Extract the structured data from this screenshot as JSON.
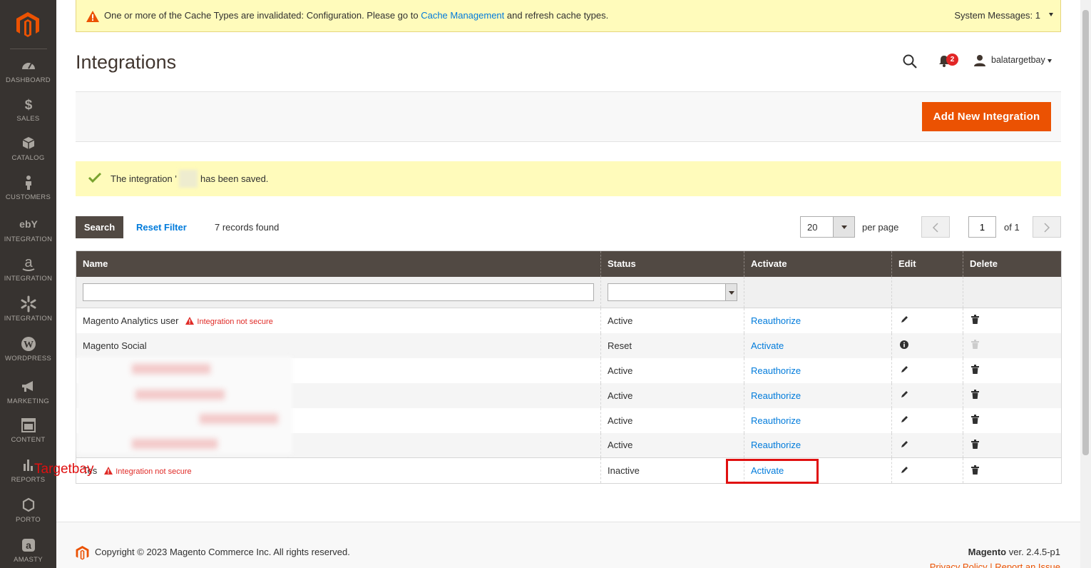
{
  "colors": {
    "sidebar": "#373330",
    "accent": "#eb5202",
    "link": "#007bdb",
    "header_bar": "#514943",
    "warning": "#e02b27"
  },
  "sidebar": {
    "items": [
      {
        "label": "DASHBOARD",
        "icon": "dashboard-icon"
      },
      {
        "label": "SALES",
        "icon": "dollar-icon"
      },
      {
        "label": "CATALOG",
        "icon": "cube-icon"
      },
      {
        "label": "CUSTOMERS",
        "icon": "person-icon"
      },
      {
        "label": "INTEGRATION",
        "icon": "ebay-icon"
      },
      {
        "label": "INTEGRATION",
        "icon": "amazon-icon"
      },
      {
        "label": "INTEGRATION",
        "icon": "walmart-icon"
      },
      {
        "label": "WORDPRESS",
        "icon": "wordpress-icon"
      },
      {
        "label": "MARKETING",
        "icon": "megaphone-icon"
      },
      {
        "label": "CONTENT",
        "icon": "content-icon"
      },
      {
        "label": "REPORTS",
        "icon": "bar-chart-icon"
      },
      {
        "label": "PORTO",
        "icon": "hexagon-icon"
      },
      {
        "label": "AMASTY",
        "icon": "amasty-icon"
      }
    ]
  },
  "system_message": {
    "text_before": "One or more of the Cache Types are invalidated: Configuration. Please go to ",
    "link": "Cache Management",
    "text_after": " and refresh cache types.",
    "count": "System Messages: 1"
  },
  "header": {
    "title": "Integrations",
    "notifications": "2",
    "username": "balatargetbay"
  },
  "actions": {
    "add_new": "Add New Integration"
  },
  "success": {
    "before": "The integration '",
    "after": "has been saved."
  },
  "grid": {
    "search": "Search",
    "reset_filter": "Reset Filter",
    "records": "7 records found",
    "per_page_value": "20",
    "per_page_label": "per page",
    "page": "1",
    "of": "of 1",
    "columns": [
      "Name",
      "Status",
      "Activate",
      "Edit",
      "Delete"
    ],
    "not_secure": "Integration not secure",
    "rows": [
      {
        "name": "Magento Analytics user",
        "status": "Active",
        "activate": "Reauthorize"
      },
      {
        "name": "Magento Social",
        "status": "Reset",
        "activate": "Activate"
      },
      {
        "name": "",
        "status": "Active",
        "activate": "Reauthorize"
      },
      {
        "name": "",
        "status": "Active",
        "activate": "Reauthorize"
      },
      {
        "name": "",
        "status": "Active",
        "activate": "Reauthorize"
      },
      {
        "name": "",
        "status": "Active",
        "activate": "Reauthorize"
      },
      {
        "name": "Tes",
        "status": "Inactive",
        "activate": "Activate"
      }
    ]
  },
  "annotation": {
    "label": "Targetbay"
  },
  "footer": {
    "copyright": "Copyright © 2023 Magento Commerce Inc. All rights reserved.",
    "brand": "Magento",
    "version": " ver. 2.4.5-p1",
    "links": "Privacy Policy | Report an Issue"
  }
}
